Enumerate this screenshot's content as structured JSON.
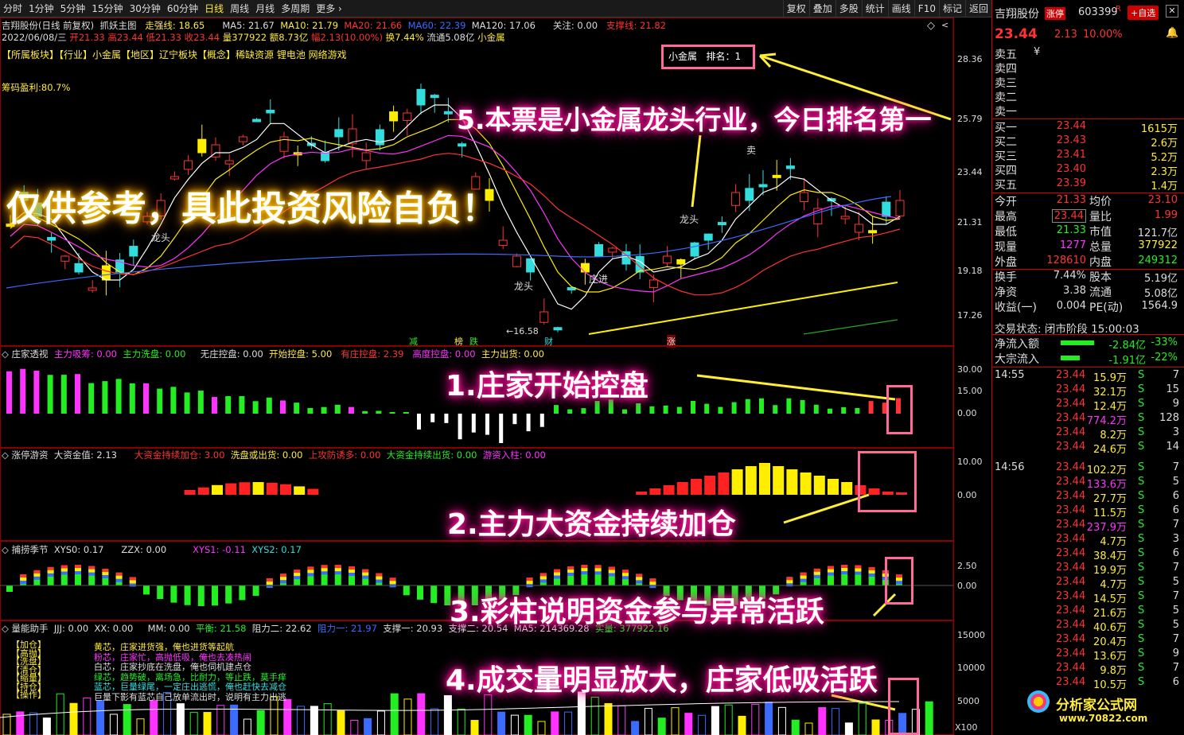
{
  "toolbar": {
    "periods": [
      "分时",
      "1分钟",
      "5分钟",
      "15分钟",
      "30分钟",
      "60分钟",
      "日线",
      "周线",
      "月线",
      "多周期",
      "更多 ›"
    ],
    "right": [
      "复权",
      "叠加",
      "多股",
      "统计",
      "画线",
      "F10",
      "标记",
      "返回"
    ]
  },
  "header": {
    "stock_line": "吉翔股份(日线 前复权)",
    "formula": "抓妖主图",
    "trend_label": "走强线: 18.65",
    "ma5": "MA5: 21.67",
    "ma10": "MA10: 21.79",
    "ma20": "MA20: 21.66",
    "ma60": "MA60: 22.39",
    "ma120": "MA120: 17.06",
    "focus": "关注: 0.00",
    "support": "支撑线: 21.82",
    "date": "2022/06/08/三",
    "open": "开21.33",
    "high": "高23.44",
    "low": "低21.33",
    "close": "收23.44",
    "vol": "量377922",
    "amt": "额8.73亿",
    "chg": "幅2.13(10.00%)",
    "turn": "换7.44%",
    "float": "流通5.08亿",
    "industry_tag": "小金属",
    "sector_line": "【所属板块】【行业】小金属【地区】辽宁板块【概念】稀缺资源 锂电池 网络游戏",
    "profit": "筹码盈利:80.7%",
    "rank_box": "小金属   排名：1"
  },
  "main_ticks": [
    "28.36",
    "25.79",
    "23.44",
    "21.31",
    "19.18",
    "17.26"
  ],
  "labels": {
    "longtou": "龙头",
    "zhuangjin": "庄进",
    "sell": "卖",
    "low_price": "←16.58",
    "reduce": "减",
    "bang": "榜",
    "die": "跌",
    "cai": "财",
    "zhang": "涨"
  },
  "panel1": {
    "title": "庄家透视",
    "items": [
      "主力吸筹: 0.00",
      "主力洗盘: 0.00",
      "无庄控盘: 0.00",
      "开始控盘: 5.00",
      "有庄控盘: 2.39",
      "高度控盘: 0.00",
      "主力出货: 0.00"
    ],
    "ticks": [
      "30.00",
      "15.00",
      "0.00"
    ]
  },
  "panel2": {
    "title": "涨停游资",
    "items": [
      "大资金值: 2.13",
      "大资金持续加仓: 3.00",
      "洗盘或出货: 0.00",
      "上攻防诱多: 0.00",
      "大资金持续出货: 0.00",
      "游资入柱: 0.00"
    ],
    "ticks": [
      "10.00",
      "0.00"
    ]
  },
  "panel3": {
    "title": "捕捞季节",
    "items": [
      "XYS0: 0.17",
      "ZZX: 0.00",
      "XYS1: -0.11",
      "XYS2: 0.17"
    ],
    "ticks": [
      "2.50",
      "0.00"
    ]
  },
  "panel4": {
    "title": "量能助手",
    "items": [
      "JJJ: 0.00",
      "XX: 0.00",
      "MM: 0.00",
      "平衡: 21.58",
      "阻力二: 22.62",
      "阻力一: 21.97",
      "支撑一: 20.93",
      "支撑二: 20.54",
      "MA5: 214369.28",
      "实量: 377922.16"
    ],
    "ticks": [
      "15000",
      "10000",
      "5000"
    ],
    "unit": "X100",
    "legend_tags": [
      "【加仓】",
      "【高抛】",
      "【洗盘】",
      "【清仓】",
      "【缩量】",
      "【持仓】",
      "【操作】"
    ],
    "legend_text": [
      "黄芯，庄家进货强，俺也进货等起航",
      "粉芯，庄家忙，高抛低吸，俺也去凑热闹",
      "白芯，庄家抄底在洗盘，俺也伺机建点仓",
      "绿芯，趋势破，离场急，比耐力，等止跌，莫手痒",
      "蓝芯，巨量绿尾，一定庄出逃慌，俺也赶快去减仓",
      "巨量下影有蓝芯自己放单流出时，说明有主力出逃"
    ]
  },
  "annotations": {
    "a1": "1.庄家开始控盘",
    "a2": "2.主力大资金持续加仓",
    "a3": "3.彩柱说明资金参与异常活跃",
    "a4": "4.成交量明显放大，庄家低吸活跃",
    "a5": "5.本票是小金属龙头行业，今日排名第一",
    "warn": "仅供参考，具此投资风险自负！"
  },
  "quote": {
    "name": "吉翔股份",
    "flag": "涨停",
    "code": "603399",
    "r": "R",
    "self_btn": "+自选",
    "price": "23.44",
    "chg": "2.13",
    "pct": "10.00%",
    "asks": [
      {
        "l": "卖五",
        "p": "¥",
        "v": ""
      },
      {
        "l": "卖四",
        "p": "",
        "v": ""
      },
      {
        "l": "卖三",
        "p": "",
        "v": ""
      },
      {
        "l": "卖二",
        "p": "",
        "v": ""
      },
      {
        "l": "卖一",
        "p": "",
        "v": ""
      }
    ],
    "bids": [
      {
        "l": "买一",
        "p": "23.44",
        "v": "1615万"
      },
      {
        "l": "买二",
        "p": "23.43",
        "v": "2.6万"
      },
      {
        "l": "买三",
        "p": "23.41",
        "v": "5.2万"
      },
      {
        "l": "买四",
        "p": "23.40",
        "v": "2.3万"
      },
      {
        "l": "买五",
        "p": "23.39",
        "v": "1.4万"
      }
    ],
    "stats": [
      {
        "l1": "今开",
        "v1": "21.33",
        "l2": "均价",
        "v2": "23.10"
      },
      {
        "l1": "最高",
        "v1": "23.44",
        "l2": "量比",
        "v2": "1.99"
      },
      {
        "l1": "最低",
        "v1": "21.33",
        "l2": "市值",
        "v2": "121.7亿"
      },
      {
        "l1": "现量",
        "v1": "1277",
        "l2": "总量",
        "v2": "377922"
      },
      {
        "l1": "外盘",
        "v1": "128610",
        "l2": "内盘",
        "v2": "249312"
      },
      {
        "l1": "换手",
        "v1": "7.44%",
        "l2": "股本",
        "v2": "5.19亿"
      },
      {
        "l1": "净资",
        "v1": "3.38",
        "l2": "流通",
        "v2": "5.08亿"
      },
      {
        "l1": "收益(一)",
        "v1": "0.004",
        "l2": "PE(动)",
        "v2": "1564.9"
      }
    ],
    "status": "交易状态: 闭市阶段 15:00:03",
    "flows": [
      {
        "l": "净流入额",
        "v": "-2.84亿",
        "p": "-33%"
      },
      {
        "l": "大宗流入",
        "v": "-1.91亿",
        "p": "-22%"
      }
    ],
    "ticks": [
      {
        "t": "14:55",
        "p": "23.44",
        "v": "15.9万",
        "s": "S",
        "n": "7"
      },
      {
        "t": "",
        "p": "23.44",
        "v": "32.1万",
        "s": "S",
        "n": "15"
      },
      {
        "t": "",
        "p": "23.44",
        "v": "12.4万",
        "s": "S",
        "n": "9"
      },
      {
        "t": "",
        "p": "23.44",
        "v": "774.2万",
        "s": "S",
        "n": "128"
      },
      {
        "t": "",
        "p": "23.44",
        "v": "8.2万",
        "s": "S",
        "n": "3"
      },
      {
        "t": "",
        "p": "23.44",
        "v": "24.6万",
        "s": "S",
        "n": "14"
      },
      {
        "t": "14:56",
        "p": "23.44",
        "v": "102.2万",
        "s": "S",
        "n": "7"
      },
      {
        "t": "",
        "p": "23.44",
        "v": "133.6万",
        "s": "S",
        "n": "5"
      },
      {
        "t": "",
        "p": "23.44",
        "v": "27.7万",
        "s": "S",
        "n": "6"
      },
      {
        "t": "",
        "p": "23.44",
        "v": "11.5万",
        "s": "S",
        "n": "6"
      },
      {
        "t": "",
        "p": "23.44",
        "v": "237.9万",
        "s": "S",
        "n": "7"
      },
      {
        "t": "",
        "p": "23.44",
        "v": "4.7万",
        "s": "S",
        "n": "3"
      },
      {
        "t": "",
        "p": "23.44",
        "v": "38.4万",
        "s": "S",
        "n": "6"
      },
      {
        "t": "",
        "p": "23.44",
        "v": "19.9万",
        "s": "S",
        "n": "7"
      },
      {
        "t": "",
        "p": "23.44",
        "v": "4.7万",
        "s": "S",
        "n": "5"
      },
      {
        "t": "",
        "p": "23.44",
        "v": "14.5万",
        "s": "S",
        "n": "7"
      },
      {
        "t": "",
        "p": "23.44",
        "v": "21.6万",
        "s": "S",
        "n": "5"
      },
      {
        "t": "",
        "p": "23.44",
        "v": "40.6万",
        "s": "S",
        "n": "5"
      },
      {
        "t": "",
        "p": "23.44",
        "v": "20.4万",
        "s": "S",
        "n": "7"
      },
      {
        "t": "",
        "p": "23.44",
        "v": "13.6万",
        "s": "S",
        "n": "9"
      },
      {
        "t": "",
        "p": "23.44",
        "v": "9.8万",
        "s": "S",
        "n": "7"
      },
      {
        "t": "",
        "p": "23.44",
        "v": "10.5万",
        "s": "S",
        "n": "6"
      }
    ],
    "site": "分析家公式网",
    "site_url": "www.70822.com"
  }
}
